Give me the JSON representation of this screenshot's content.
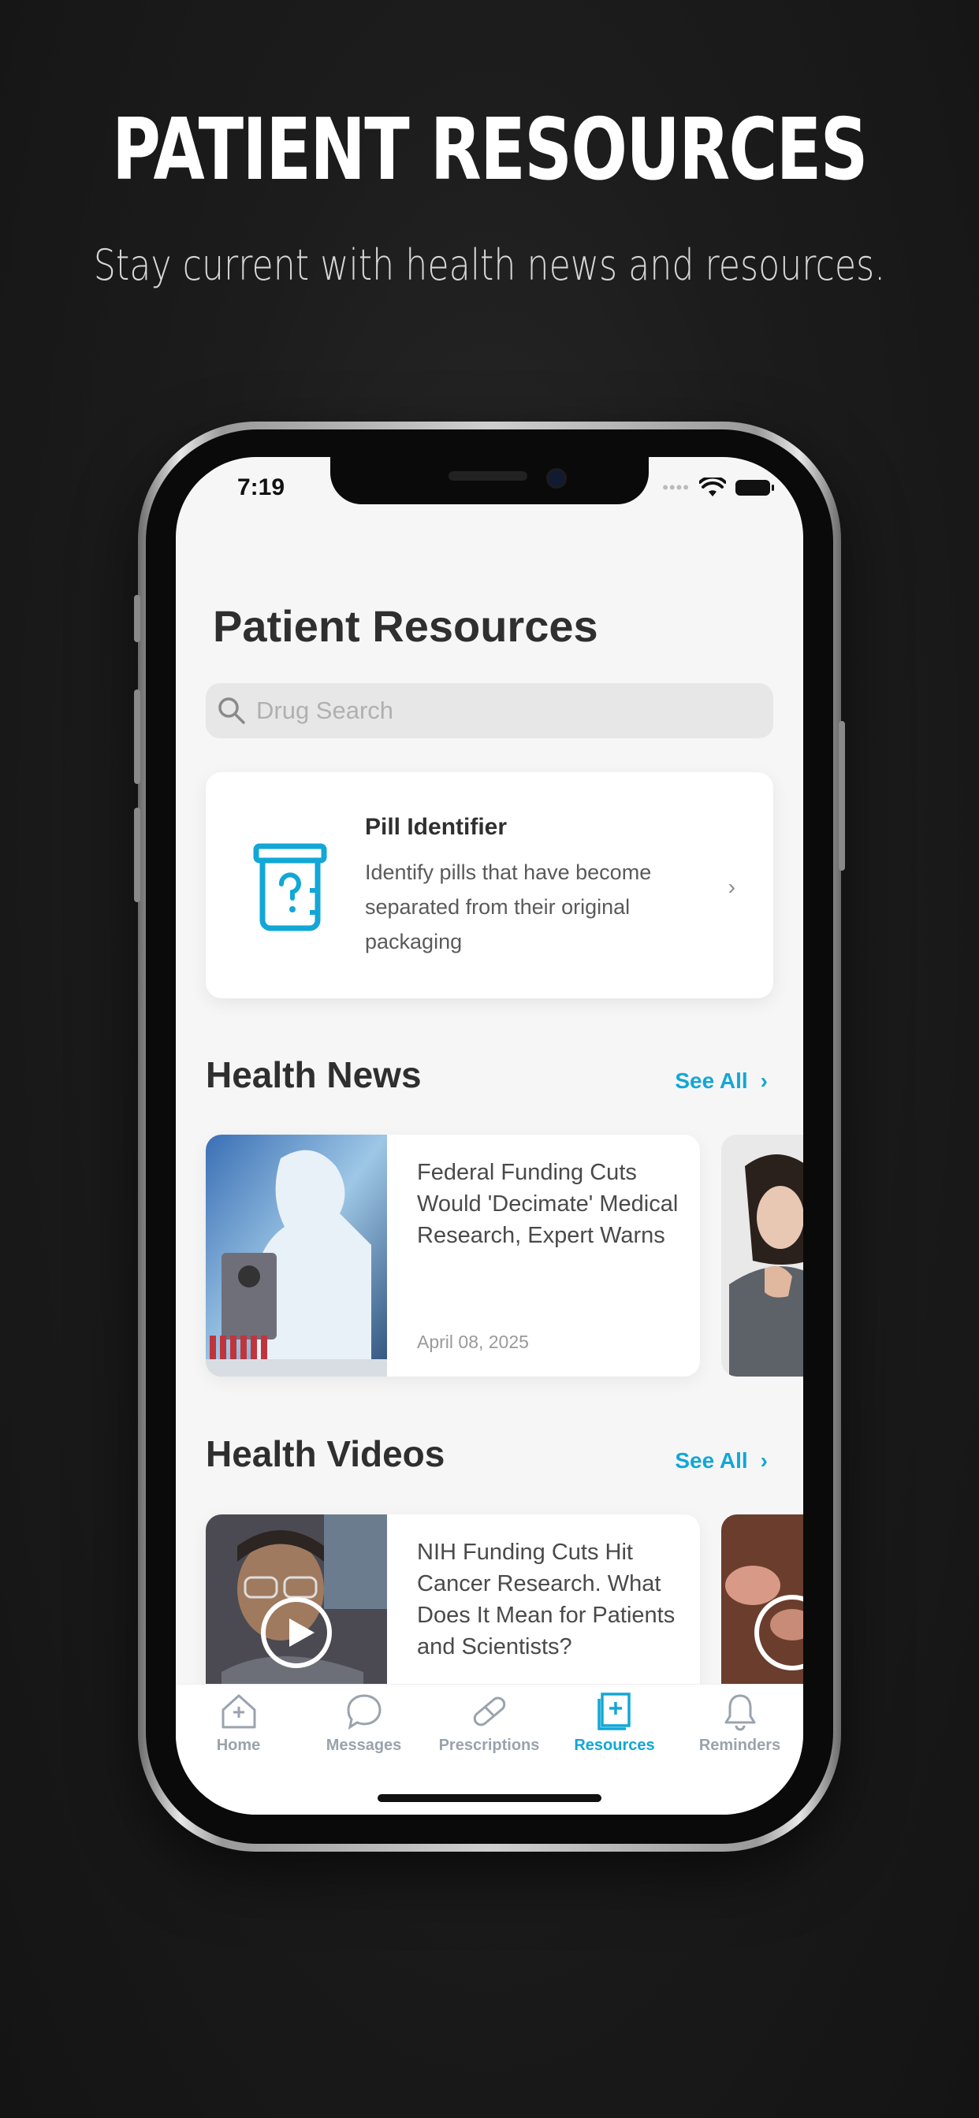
{
  "promo": {
    "title": "PATIENT RESOURCES",
    "subtitle": "Stay current with health news and resources."
  },
  "status_bar": {
    "time": "7:19"
  },
  "page": {
    "title": "Patient Resources"
  },
  "search": {
    "placeholder": "Drug Search"
  },
  "pill_identifier": {
    "title": "Pill Identifier",
    "description": "Identify pills that have become separated from their original packaging"
  },
  "health_news": {
    "title": "Health News",
    "see_all": "See All",
    "items": [
      {
        "title": "Federal Funding Cuts Would 'Decimate' Medical Research, Expert Warns",
        "date": "April 08, 2025"
      }
    ]
  },
  "health_videos": {
    "title": "Health Videos",
    "see_all": "See All",
    "items": [
      {
        "title": "NIH Funding Cuts Hit Cancer Research. What Does It Mean for Patients and Scientists?"
      }
    ]
  },
  "tabbar": {
    "items": [
      {
        "label": "Home",
        "icon": "home-plus-icon"
      },
      {
        "label": "Messages",
        "icon": "chat-bubble-icon"
      },
      {
        "label": "Prescriptions",
        "icon": "pill-capsule-icon"
      },
      {
        "label": "Resources",
        "icon": "book-plus-icon",
        "active": true
      },
      {
        "label": "Reminders",
        "icon": "bell-icon"
      }
    ]
  },
  "colors": {
    "accent": "#12a7d6",
    "background": "#f6f6f6",
    "promo_background": "#1c1c1c"
  }
}
